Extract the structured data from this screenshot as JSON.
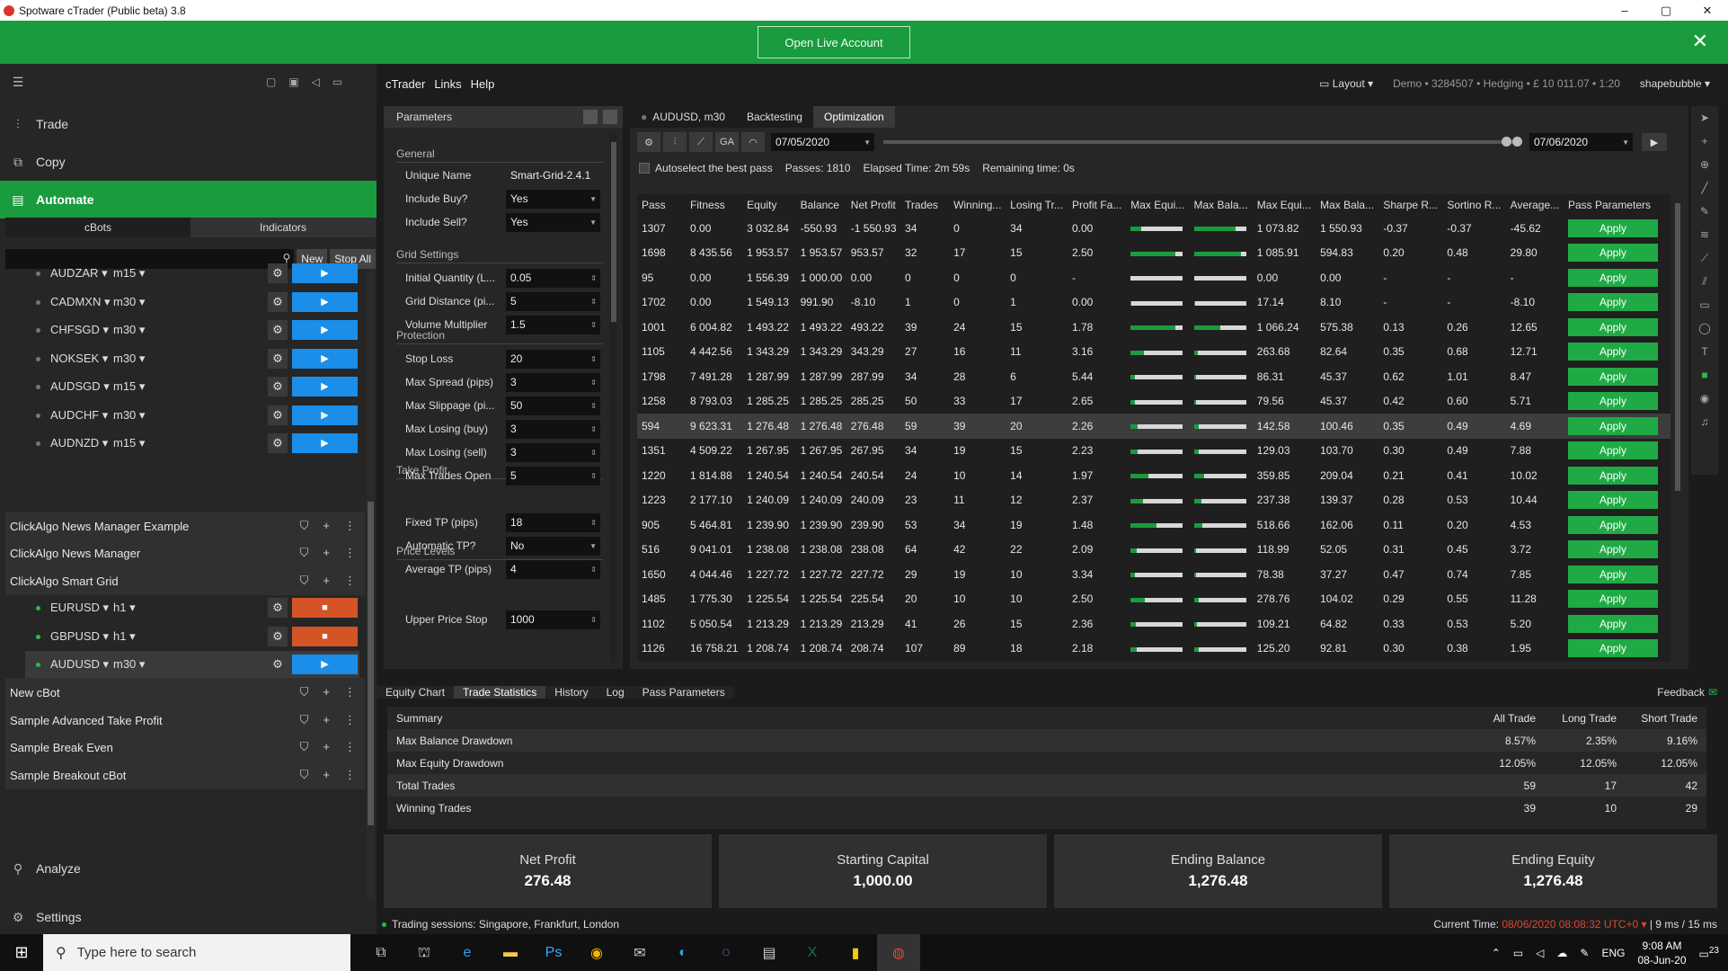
{
  "window": {
    "title": "Spotware cTrader (Public beta) 3.8",
    "min": "–",
    "max": "▢",
    "close": "✕"
  },
  "promo": {
    "button": "Open Live Account",
    "close": "✕"
  },
  "nav": {
    "trade": "Trade",
    "copy": "Copy",
    "automate": "Automate",
    "analyze": "Analyze",
    "settings": "Settings"
  },
  "subtabs": {
    "cbots": "cBots",
    "indicators": "Indicators"
  },
  "searchbar": {
    "new": "New",
    "stop_all": "Stop All"
  },
  "instances_top": [
    {
      "symbol": "AUDZAR",
      "tf": "m15"
    },
    {
      "symbol": "CADMXN",
      "tf": "m30"
    },
    {
      "symbol": "CHFSGD",
      "tf": "m30"
    },
    {
      "symbol": "NOKSEK",
      "tf": "m30"
    },
    {
      "symbol": "AUDSGD",
      "tf": "m15"
    },
    {
      "symbol": "AUDCHF",
      "tf": "m30"
    },
    {
      "symbol": "AUDNZD",
      "tf": "m15"
    }
  ],
  "bots_a": [
    "ClickAlgo News Manager Example",
    "ClickAlgo News Manager",
    "ClickAlgo Smart Grid"
  ],
  "instances_running": [
    {
      "symbol": "EURUSD",
      "tf": "h1"
    },
    {
      "symbol": "GBPUSD",
      "tf": "h1"
    },
    {
      "symbol": "AUDUSD",
      "tf": "m30"
    }
  ],
  "bots_b": [
    "New cBot",
    "Sample Advanced Take Profit",
    "Sample Break Even",
    "Sample Breakout cBot"
  ],
  "menu": {
    "ctrader": "cTrader",
    "links": "Links",
    "help": "Help",
    "layout": "Layout",
    "account": "Demo • 3284507 • Hedging • £ 10 011.07 • 1:20",
    "user": "shapebubble"
  },
  "params": {
    "title": "Parameters",
    "general": "General",
    "grid_settings": "Grid Settings",
    "protection": "Protection",
    "take_profit": "Take Profit",
    "price_levels": "Price Levels",
    "rows": [
      {
        "label": "Unique Name",
        "value": "Smart-Grid-2.4.1"
      },
      {
        "label": "Include Buy?",
        "value": "Yes"
      },
      {
        "label": "Include Sell?",
        "value": "Yes"
      },
      {
        "label": "Initial Quantity (L...",
        "value": "0.05"
      },
      {
        "label": "Grid Distance (pi...",
        "value": "5"
      },
      {
        "label": "Volume Multiplier",
        "value": "1.5"
      },
      {
        "label": "Stop Loss",
        "value": "20"
      },
      {
        "label": "Max Spread (pips)",
        "value": "3"
      },
      {
        "label": "Max Slippage (pi...",
        "value": "50"
      },
      {
        "label": "Max Losing (buy)",
        "value": "3"
      },
      {
        "label": "Max Losing (sell)",
        "value": "3"
      },
      {
        "label": "Max Trades Open",
        "value": "5"
      },
      {
        "label": "Fixed TP (pips)",
        "value": "18"
      },
      {
        "label": "Automatic TP?",
        "value": "No"
      },
      {
        "label": "Average TP (pips)",
        "value": "4"
      },
      {
        "label": "Upper Price Stop",
        "value": "1000"
      }
    ]
  },
  "opt": {
    "tab_symbol": "AUDUSD, m30",
    "tab_backtesting": "Backtesting",
    "tab_optimization": "Optimization",
    "ga": "GA",
    "date_from": "07/05/2020",
    "date_to": "07/06/2020",
    "autoselect": "Autoselect the best pass",
    "passes": "Passes:  1810",
    "elapsed": "Elapsed Time:  2m 59s",
    "remaining": "Remaining time:  0s"
  },
  "results": {
    "headers": [
      "Pass",
      "Fitness",
      "Equity",
      "Balance",
      "Net Profit",
      "Trades",
      "Winning...",
      "Losing Tr...",
      "Profit Fa...",
      "Max Equi...",
      "Max Bala...",
      "Max Equi...",
      "Max Bala...",
      "Sharpe R...",
      "Sortino R...",
      "Average...",
      "Pass Parameters"
    ],
    "apply": "Apply",
    "rows": [
      {
        "pass": "1307",
        "fitness": "0.00",
        "equity": "3 032.84",
        "balance": "-550.93",
        "net": "-1 550.93",
        "trades": "34",
        "win": "0",
        "lose": "34",
        "pf": "0.00",
        "b1": 0.2,
        "b2": 0.8,
        "meq": "1 073.82",
        "mbal": "1 550.93",
        "sharpe": "-0.37",
        "sortino": "-0.37",
        "avg": "-45.62"
      },
      {
        "pass": "1698",
        "fitness": "8 435.56",
        "equity": "1 953.57",
        "balance": "1 953.57",
        "net": "953.57",
        "trades": "32",
        "win": "17",
        "lose": "15",
        "pf": "2.50",
        "b1": 0.85,
        "b2": 0.9,
        "meq": "1 085.91",
        "mbal": "594.83",
        "sharpe": "0.20",
        "sortino": "0.48",
        "avg": "29.80"
      },
      {
        "pass": "95",
        "fitness": "0.00",
        "equity": "1 556.39",
        "balance": "1 000.00",
        "net": "0.00",
        "trades": "0",
        "win": "0",
        "lose": "0",
        "pf": "-",
        "b1": 0,
        "b2": 0,
        "meq": "0.00",
        "mbal": "0.00",
        "sharpe": "-",
        "sortino": "-",
        "avg": "-"
      },
      {
        "pass": "1702",
        "fitness": "0.00",
        "equity": "1 549.13",
        "balance": "991.90",
        "net": "-8.10",
        "trades": "1",
        "win": "0",
        "lose": "1",
        "pf": "0.00",
        "b1": 0.02,
        "b2": 0.02,
        "meq": "17.14",
        "mbal": "8.10",
        "sharpe": "-",
        "sortino": "-",
        "avg": "-8.10"
      },
      {
        "pass": "1001",
        "fitness": "6 004.82",
        "equity": "1 493.22",
        "balance": "1 493.22",
        "net": "493.22",
        "trades": "39",
        "win": "24",
        "lose": "15",
        "pf": "1.78",
        "b1": 0.85,
        "b2": 0.5,
        "meq": "1 066.24",
        "mbal": "575.38",
        "sharpe": "0.13",
        "sortino": "0.26",
        "avg": "12.65"
      },
      {
        "pass": "1105",
        "fitness": "4 442.56",
        "equity": "1 343.29",
        "balance": "1 343.29",
        "net": "343.29",
        "trades": "27",
        "win": "16",
        "lose": "11",
        "pf": "3.16",
        "b1": 0.25,
        "b2": 0.08,
        "meq": "263.68",
        "mbal": "82.64",
        "sharpe": "0.35",
        "sortino": "0.68",
        "avg": "12.71"
      },
      {
        "pass": "1798",
        "fitness": "7 491.28",
        "equity": "1 287.99",
        "balance": "1 287.99",
        "net": "287.99",
        "trades": "34",
        "win": "28",
        "lose": "6",
        "pf": "5.44",
        "b1": 0.08,
        "b2": 0.05,
        "meq": "86.31",
        "mbal": "45.37",
        "sharpe": "0.62",
        "sortino": "1.01",
        "avg": "8.47"
      },
      {
        "pass": "1258",
        "fitness": "8 793.03",
        "equity": "1 285.25",
        "balance": "1 285.25",
        "net": "285.25",
        "trades": "50",
        "win": "33",
        "lose": "17",
        "pf": "2.65",
        "b1": 0.08,
        "b2": 0.05,
        "meq": "79.56",
        "mbal": "45.37",
        "sharpe": "0.42",
        "sortino": "0.60",
        "avg": "5.71"
      },
      {
        "pass": "594",
        "fitness": "9 623.31",
        "equity": "1 276.48",
        "balance": "1 276.48",
        "net": "276.48",
        "trades": "59",
        "win": "39",
        "lose": "20",
        "pf": "2.26",
        "b1": 0.14,
        "b2": 0.1,
        "meq": "142.58",
        "mbal": "100.46",
        "sharpe": "0.35",
        "sortino": "0.49",
        "avg": "4.69"
      },
      {
        "pass": "1351",
        "fitness": "4 509.22",
        "equity": "1 267.95",
        "balance": "1 267.95",
        "net": "267.95",
        "trades": "34",
        "win": "19",
        "lose": "15",
        "pf": "2.23",
        "b1": 0.13,
        "b2": 0.1,
        "meq": "129.03",
        "mbal": "103.70",
        "sharpe": "0.30",
        "sortino": "0.49",
        "avg": "7.88"
      },
      {
        "pass": "1220",
        "fitness": "1 814.88",
        "equity": "1 240.54",
        "balance": "1 240.54",
        "net": "240.54",
        "trades": "24",
        "win": "10",
        "lose": "14",
        "pf": "1.97",
        "b1": 0.34,
        "b2": 0.2,
        "meq": "359.85",
        "mbal": "209.04",
        "sharpe": "0.21",
        "sortino": "0.41",
        "avg": "10.02"
      },
      {
        "pass": "1223",
        "fitness": "2 177.10",
        "equity": "1 240.09",
        "balance": "1 240.09",
        "net": "240.09",
        "trades": "23",
        "win": "11",
        "lose": "12",
        "pf": "2.37",
        "b1": 0.23,
        "b2": 0.14,
        "meq": "237.38",
        "mbal": "139.37",
        "sharpe": "0.28",
        "sortino": "0.53",
        "avg": "10.44"
      },
      {
        "pass": "905",
        "fitness": "5 464.81",
        "equity": "1 239.90",
        "balance": "1 239.90",
        "net": "239.90",
        "trades": "53",
        "win": "34",
        "lose": "19",
        "pf": "1.48",
        "b1": 0.5,
        "b2": 0.16,
        "meq": "518.66",
        "mbal": "162.06",
        "sharpe": "0.11",
        "sortino": "0.20",
        "avg": "4.53"
      },
      {
        "pass": "516",
        "fitness": "9 041.01",
        "equity": "1 238.08",
        "balance": "1 238.08",
        "net": "238.08",
        "trades": "64",
        "win": "42",
        "lose": "22",
        "pf": "2.09",
        "b1": 0.12,
        "b2": 0.05,
        "meq": "118.99",
        "mbal": "52.05",
        "sharpe": "0.31",
        "sortino": "0.45",
        "avg": "3.72"
      },
      {
        "pass": "1650",
        "fitness": "4 044.46",
        "equity": "1 227.72",
        "balance": "1 227.72",
        "net": "227.72",
        "trades": "29",
        "win": "19",
        "lose": "10",
        "pf": "3.34",
        "b1": 0.08,
        "b2": 0.04,
        "meq": "78.38",
        "mbal": "37.27",
        "sharpe": "0.47",
        "sortino": "0.74",
        "avg": "7.85"
      },
      {
        "pass": "1485",
        "fitness": "1 775.30",
        "equity": "1 225.54",
        "balance": "1 225.54",
        "net": "225.54",
        "trades": "20",
        "win": "10",
        "lose": "10",
        "pf": "2.50",
        "b1": 0.27,
        "b2": 0.1,
        "meq": "278.76",
        "mbal": "104.02",
        "sharpe": "0.29",
        "sortino": "0.55",
        "avg": "11.28"
      },
      {
        "pass": "1102",
        "fitness": "5 050.54",
        "equity": "1 213.29",
        "balance": "1 213.29",
        "net": "213.29",
        "trades": "41",
        "win": "26",
        "lose": "15",
        "pf": "2.36",
        "b1": 0.1,
        "b2": 0.06,
        "meq": "109.21",
        "mbal": "64.82",
        "sharpe": "0.33",
        "sortino": "0.53",
        "avg": "5.20"
      },
      {
        "pass": "1126",
        "fitness": "16 758.21",
        "equity": "1 208.74",
        "balance": "1 208.74",
        "net": "208.74",
        "trades": "107",
        "win": "89",
        "lose": "18",
        "pf": "2.18",
        "b1": 0.12,
        "b2": 0.09,
        "meq": "125.20",
        "mbal": "92.81",
        "sharpe": "0.30",
        "sortino": "0.38",
        "avg": "1.95"
      }
    ]
  },
  "bottom": {
    "tabs": [
      "Equity Chart",
      "Trade Statistics",
      "History",
      "Log",
      "Pass Parameters"
    ],
    "feedback": "Feedback",
    "summary_header": "Summary",
    "col_all": "All Trade",
    "col_long": "Long Trade",
    "col_short": "Short Trade",
    "stats": [
      {
        "label": "Max Balance Drawdown",
        "all": "8.57%",
        "long": "2.35%",
        "short": "9.16%"
      },
      {
        "label": "Max Equity Drawdown",
        "all": "12.05%",
        "long": "12.05%",
        "short": "12.05%"
      },
      {
        "label": "Total Trades",
        "all": "59",
        "long": "17",
        "short": "42"
      },
      {
        "label": "Winning Trades",
        "all": "39",
        "long": "10",
        "short": "29"
      }
    ],
    "cards": [
      {
        "title": "Net Profit",
        "value": "276.48"
      },
      {
        "title": "Starting Capital",
        "value": "1,000.00"
      },
      {
        "title": "Ending Balance",
        "value": "1,276.48"
      },
      {
        "title": "Ending Equity",
        "value": "1,276.48"
      }
    ]
  },
  "status": {
    "sessions": "Trading sessions: Singapore, Frankfurt, London",
    "current_time_label": "Current Time:",
    "current_time": "08/06/2020 08:08:32",
    "tz": "UTC+0",
    "ping": "| 9 ms / 15 ms"
  },
  "taskbar": {
    "search": "Type here to search",
    "lang": "ENG",
    "time": "9:08 AM",
    "date": "08-Jun-20",
    "notif": "23"
  }
}
